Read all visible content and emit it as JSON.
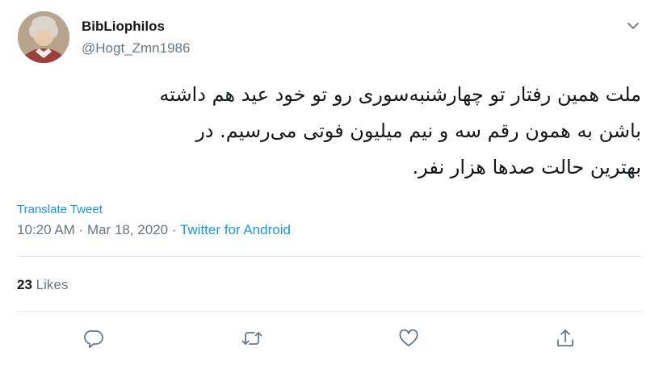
{
  "user": {
    "display_name": "BibLiophilos",
    "handle": "@Hogt_Zmn1986",
    "avatar_icon": "portrait-avatar"
  },
  "tweet": {
    "text_lines": [
      "ملت همین رفتار تو چهارشنبه‌سوری رو تو خود عید هم داشته",
      "باشن به همون رقم سه و نیم میلیون فوتی می‌رسیم. در",
      "بهترین حالت صدها هزار نفر."
    ],
    "translate_label": "Translate Tweet",
    "time": "10:20 AM",
    "separator_1": " · ",
    "date": "Mar 18, 2020",
    "separator_2": " · ",
    "source": "Twitter for Android"
  },
  "stats": {
    "likes_count": "23",
    "likes_label": " Likes"
  },
  "actions": [
    {
      "icon": "reply-icon"
    },
    {
      "icon": "retweet-icon"
    },
    {
      "icon": "like-icon"
    },
    {
      "icon": "share-icon"
    }
  ],
  "colors": {
    "link": "#1b95e0",
    "muted": "#657786",
    "text": "#14171a",
    "divider": "#e6ecf0"
  }
}
